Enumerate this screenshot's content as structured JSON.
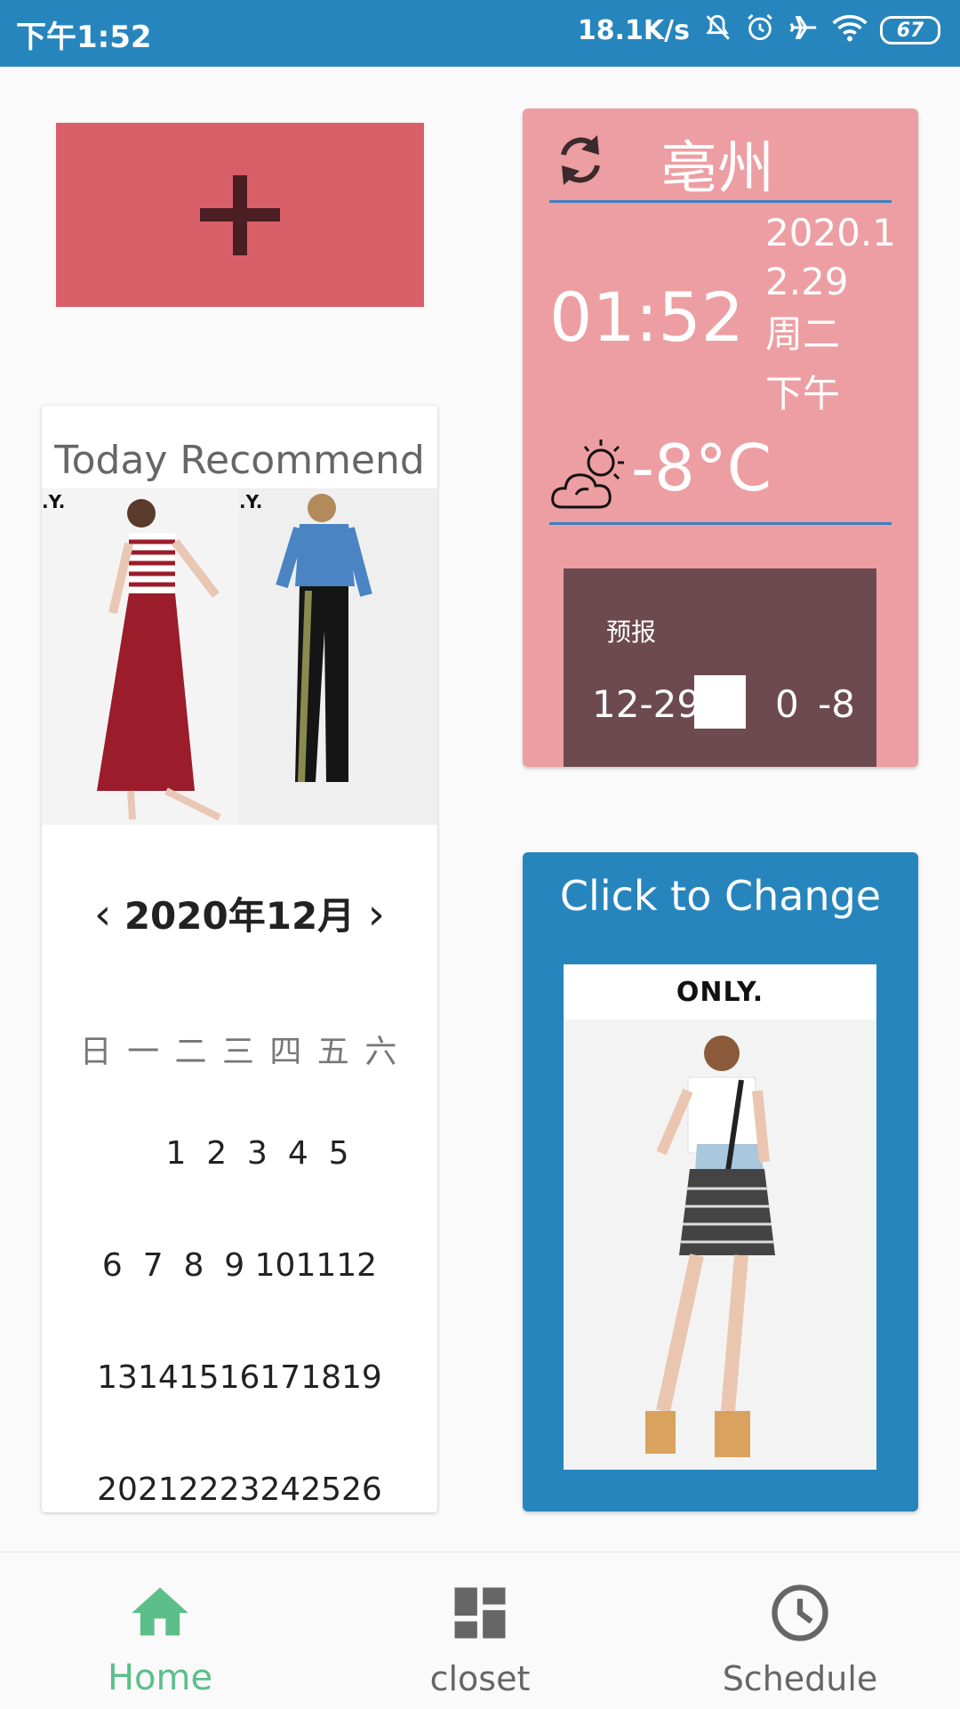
{
  "status_bar": {
    "time": "下午1:52",
    "network_speed": "18.1K/s",
    "battery": "67",
    "icons": [
      "mute-icon",
      "alarm-icon",
      "airplane-icon",
      "wifi-icon",
      "battery-icon"
    ]
  },
  "add_button": {
    "icon": "plus-icon"
  },
  "weather": {
    "city": "亳州",
    "time": "01:52",
    "date_line1": "2020.1",
    "date_line2": "2.29",
    "weekday": "周二",
    "period": "下午",
    "temperature": "-8°C",
    "weather_icon": "partly-cloudy-icon",
    "forecast": {
      "title": "预报",
      "date": "12-29",
      "range": "0 -8"
    }
  },
  "recommend": {
    "title": "Today Recommend"
  },
  "calendar": {
    "month": "2020年12月",
    "weekdays": "日 一 二 三 四 五 六",
    "rows": [
      "1  2  3  4  5",
      "6  7  8  9 101112",
      "13141516171819",
      "20212223242526"
    ]
  },
  "change": {
    "title": "Click to Change",
    "brand": "ONLY."
  },
  "nav": [
    {
      "label": "Home",
      "icon": "home-icon",
      "active": true
    },
    {
      "label": "closet",
      "icon": "dashboard-icon",
      "active": false
    },
    {
      "label": "Schedule",
      "icon": "clock-icon",
      "active": false
    }
  ],
  "colors": {
    "primary": "#2785bd",
    "add_button": "#d85f68",
    "weather_card": "#ed9ea2",
    "forecast_bg": "#6d4a4f",
    "nav_active": "#5cbf8a",
    "nav_inactive": "#666666"
  }
}
